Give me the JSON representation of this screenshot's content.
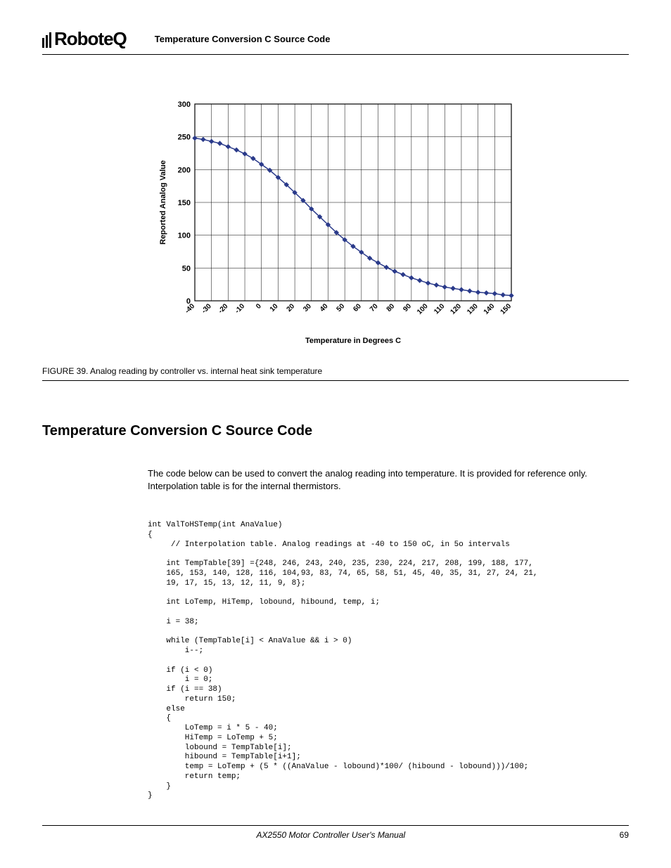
{
  "header": {
    "logo_text": "RoboteQ",
    "title": "Temperature Conversion C Source Code"
  },
  "chart_data": {
    "type": "line",
    "title": "",
    "xlabel": "Temperature in Degrees C",
    "ylabel": "Reported Analog Value",
    "xlim": [
      -40,
      150
    ],
    "ylim": [
      0,
      300
    ],
    "x_ticks": [
      -40,
      -30,
      -20,
      -10,
      0,
      10,
      20,
      30,
      40,
      50,
      60,
      70,
      80,
      90,
      100,
      110,
      120,
      130,
      140,
      150
    ],
    "y_ticks": [
      0,
      50,
      100,
      150,
      200,
      250,
      300
    ],
    "x": [
      -40,
      -35,
      -30,
      -25,
      -20,
      -15,
      -10,
      -5,
      0,
      5,
      10,
      15,
      20,
      25,
      30,
      35,
      40,
      45,
      50,
      55,
      60,
      65,
      70,
      75,
      80,
      85,
      90,
      95,
      100,
      105,
      110,
      115,
      120,
      125,
      130,
      135,
      140,
      145,
      150
    ],
    "y": [
      248,
      246,
      243,
      240,
      235,
      230,
      224,
      217,
      208,
      199,
      188,
      177,
      165,
      153,
      140,
      128,
      116,
      104,
      93,
      83,
      74,
      65,
      58,
      51,
      45,
      40,
      35,
      31,
      27,
      24,
      21,
      19,
      17,
      15,
      13,
      12,
      11,
      9,
      8
    ]
  },
  "figure": {
    "caption": "FIGURE 39.  Analog reading by controller vs. internal heat sink temperature"
  },
  "section": {
    "title": "Temperature Conversion C Source Code",
    "body": "The code below can be used to convert the analog reading into temperature. It is provided for reference only. Interpolation table is for the internal thermistors."
  },
  "code": "int ValToHSTemp(int AnaValue)\n{\n     // Interpolation table. Analog readings at -40 to 150 oC, in 5o intervals\n\n    int TempTable[39] ={248, 246, 243, 240, 235, 230, 224, 217, 208, 199, 188, 177,\n    165, 153, 140, 128, 116, 104,93, 83, 74, 65, 58, 51, 45, 40, 35, 31, 27, 24, 21,\n    19, 17, 15, 13, 12, 11, 9, 8};\n\n    int LoTemp, HiTemp, lobound, hibound, temp, i;\n\n    i = 38;\n\n    while (TempTable[i] < AnaValue && i > 0)\n        i--;\n\n    if (i < 0)\n        i = 0;\n    if (i == 38)\n        return 150;\n    else\n    {\n        LoTemp = i * 5 - 40;\n        HiTemp = LoTemp + 5;\n        lobound = TempTable[i];\n        hibound = TempTable[i+1];\n        temp = LoTemp + (5 * ((AnaValue - lobound)*100/ (hibound - lobound)))/100;\n        return temp;\n    }\n}",
  "footer": {
    "manual": "AX2550 Motor Controller User's Manual",
    "page": "69"
  }
}
